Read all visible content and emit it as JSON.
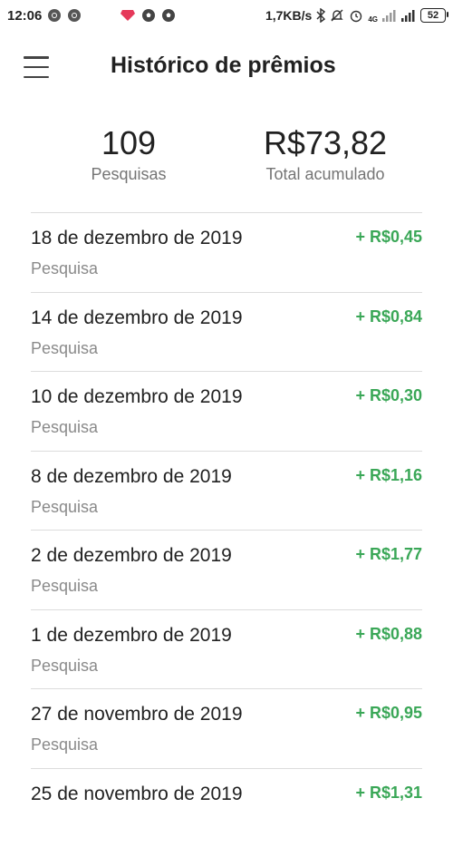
{
  "status_bar": {
    "time": "12:06",
    "speed": "1,7KB/s",
    "network": "4G",
    "battery": "52",
    "icons": [
      "chrome-icon",
      "chrome-icon",
      "diamond-icon",
      "soccer-ball-icon",
      "soccer-ball-icon",
      "bluetooth-icon",
      "mute-icon",
      "alarm-icon",
      "signal-icon",
      "signal-icon"
    ]
  },
  "header": {
    "title": "Histórico de prêmios",
    "menu_icon": "menu-icon"
  },
  "summary": {
    "searches_value": "109",
    "searches_label": "Pesquisas",
    "total_value": "R$73,82",
    "total_label": "Total acumulado"
  },
  "history": [
    {
      "date": "18 de dezembro de 2019",
      "type": "Pesquisa",
      "amount": "+ R$0,45"
    },
    {
      "date": "14 de dezembro de 2019",
      "type": "Pesquisa",
      "amount": "+ R$0,84"
    },
    {
      "date": "10 de dezembro de 2019",
      "type": "Pesquisa",
      "amount": "+ R$0,30"
    },
    {
      "date": "8 de dezembro de 2019",
      "type": "Pesquisa",
      "amount": "+ R$1,16"
    },
    {
      "date": "2 de dezembro de 2019",
      "type": "Pesquisa",
      "amount": "+ R$1,77"
    },
    {
      "date": "1 de dezembro de 2019",
      "type": "Pesquisa",
      "amount": "+ R$0,88"
    },
    {
      "date": "27 de novembro de 2019",
      "type": "Pesquisa",
      "amount": "+ R$0,95"
    },
    {
      "date": "25 de novembro de 2019",
      "type": "",
      "amount": "+ R$1,31"
    }
  ],
  "colors": {
    "accent_green": "#3aa757",
    "secondary_text": "#757575",
    "divider": "#dcdcdc"
  }
}
